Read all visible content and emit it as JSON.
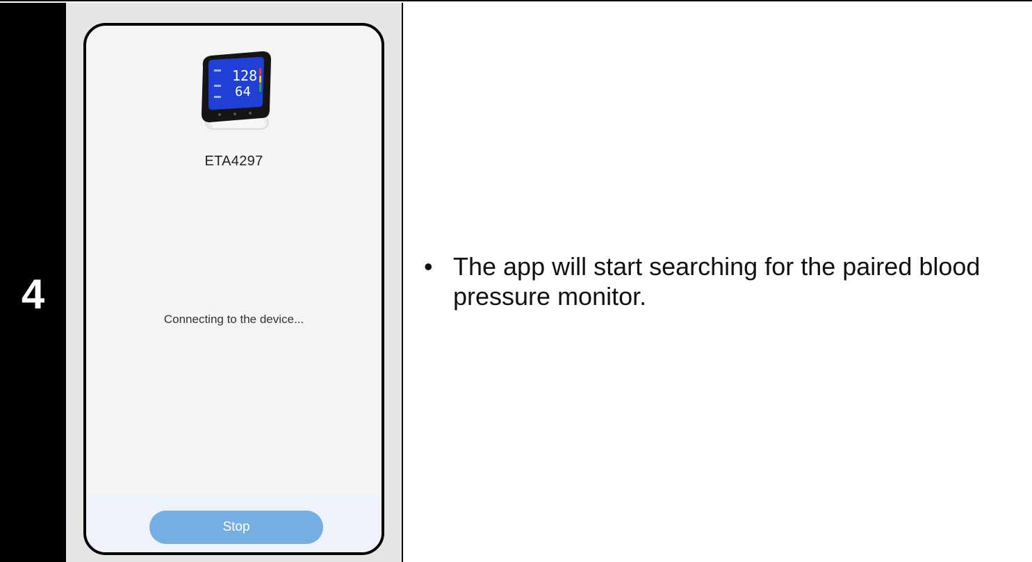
{
  "step": {
    "number": "4"
  },
  "phone": {
    "device_name": "ETA4297",
    "device_image_icon": "blood-pressure-monitor-image",
    "monitor_display": {
      "systolic": "128",
      "diastolic": "64"
    },
    "status": "Connecting to the device...",
    "stop_button_label": "Stop"
  },
  "description": {
    "bullet": "•",
    "text": "The app will start searching for the paired blood pressure monitor."
  },
  "colors": {
    "step_bg": "#000000",
    "phone_bg": "#f4f4f4",
    "bottom_bar": "#edf3f9",
    "stop_button": "#74aee3"
  }
}
